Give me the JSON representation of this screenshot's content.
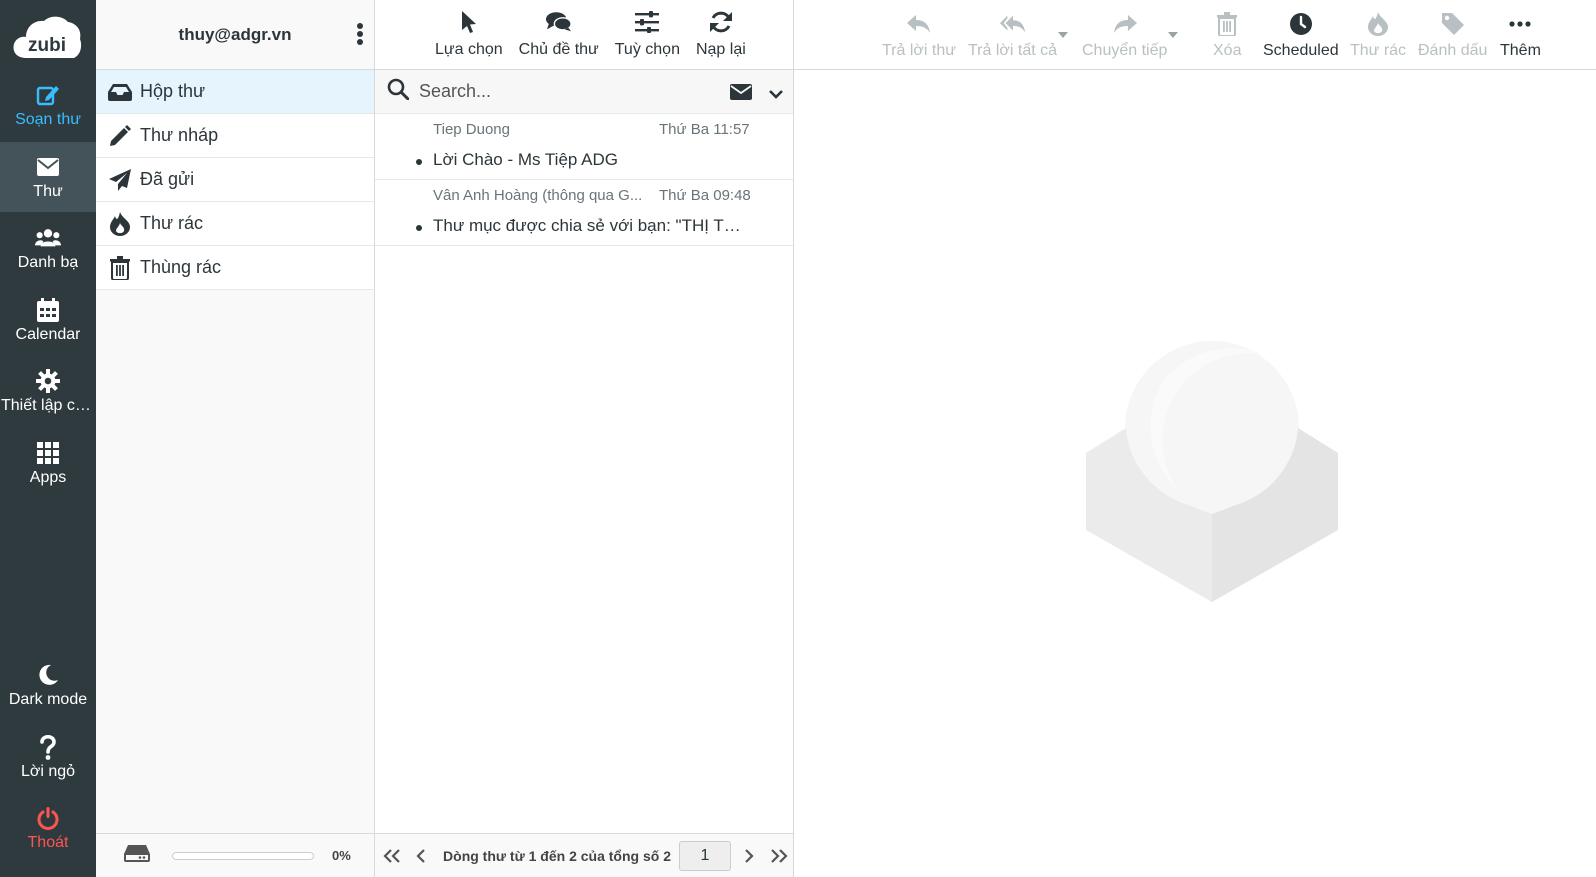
{
  "brand": {
    "logo_text": "zubi"
  },
  "nav": {
    "items": [
      {
        "label": "Soạn thư",
        "icon": "compose-icon"
      },
      {
        "label": "Thư",
        "icon": "envelope-icon"
      },
      {
        "label": "Danh bạ",
        "icon": "contacts-icon"
      },
      {
        "label": "Calendar",
        "icon": "calendar-icon"
      },
      {
        "label": "Thiết lập cấ...",
        "icon": "gear-icon"
      },
      {
        "label": "Apps",
        "icon": "apps-grid-icon"
      }
    ],
    "bottom": [
      {
        "label": "Dark mode",
        "icon": "moon-icon"
      },
      {
        "label": "Lời ngỏ",
        "icon": "question-icon"
      },
      {
        "label": "Thoát",
        "icon": "power-icon"
      }
    ],
    "colors": {
      "background": "#2f3a3f",
      "active": "#44535a",
      "compose": "#37beff",
      "logout": "#ff5552"
    }
  },
  "folders": {
    "account": "thuy@adgr.vn",
    "items": [
      {
        "label": "Hộp thư",
        "icon": "inbox-icon"
      },
      {
        "label": "Thư nháp",
        "icon": "pencil-icon"
      },
      {
        "label": "Đã gửi",
        "icon": "paper-plane-icon"
      },
      {
        "label": "Thư rác",
        "icon": "fire-icon"
      },
      {
        "label": "Thùng rác",
        "icon": "trash-icon"
      }
    ],
    "quota": {
      "percent_label": "0%",
      "used_fraction": 0
    }
  },
  "list_toolbar": {
    "buttons": [
      {
        "label": "Lựa chọn",
        "icon": "cursor-icon"
      },
      {
        "label": "Chủ đề thư",
        "icon": "comments-icon"
      },
      {
        "label": "Tuỳ chọn",
        "icon": "sliders-icon"
      },
      {
        "label": "Nạp lại",
        "icon": "refresh-icon"
      }
    ]
  },
  "search": {
    "placeholder": "Search..."
  },
  "messages": [
    {
      "from": "Tiep Duong",
      "date": "Thứ Ba 11:57",
      "subject": "Lời Chào - Ms Tiệp ADG",
      "unread": true
    },
    {
      "from": "Vân Anh Hoàng (thông qua G...",
      "date": "Thứ Ba 09:48",
      "subject": "Thư mục được chia sẻ với bạn: \"THỊ TR...",
      "unread": true
    }
  ],
  "pager": {
    "text": "Dòng thư từ 1 đến 2 của tổng số 2",
    "page": "1"
  },
  "message_toolbar": {
    "buttons": [
      {
        "label": "Trả lời thư",
        "icon": "reply-icon",
        "enabled": false
      },
      {
        "label": "Trả lời tất cả",
        "icon": "reply-all-icon",
        "enabled": false
      },
      {
        "label": "Chuyển tiếp",
        "icon": "forward-icon",
        "enabled": false
      },
      {
        "label": "Xóa",
        "icon": "trash-icon",
        "enabled": false
      },
      {
        "label": "Scheduled",
        "icon": "clock-icon",
        "enabled": true
      },
      {
        "label": "Thư rác",
        "icon": "fire-icon",
        "enabled": false
      },
      {
        "label": "Đánh dấu",
        "icon": "tag-icon",
        "enabled": false
      },
      {
        "label": "Thêm",
        "icon": "more-dots-icon",
        "enabled": true
      }
    ]
  }
}
